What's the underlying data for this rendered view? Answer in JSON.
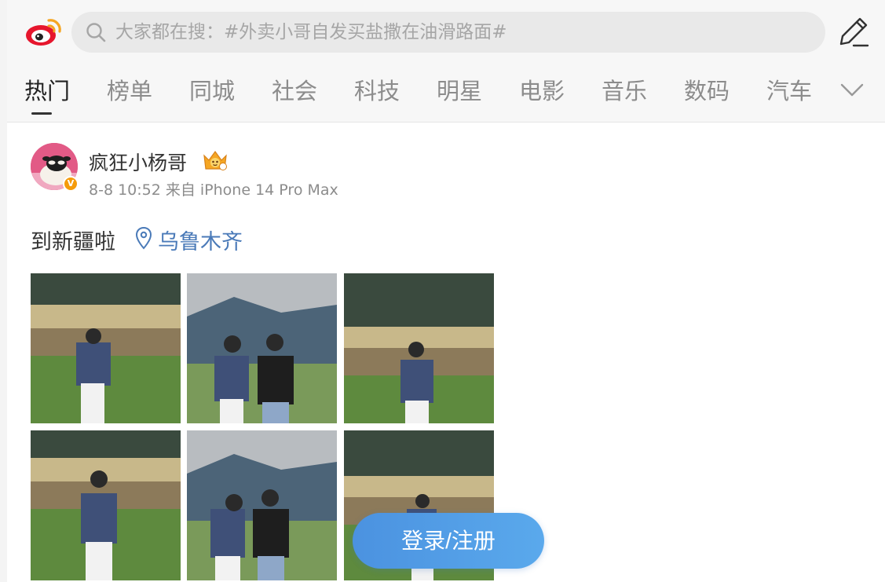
{
  "search": {
    "placeholder": "大家都在搜：#外卖小哥自发买盐撒在油滑路面#"
  },
  "tabs": [
    {
      "label": "热门",
      "active": true
    },
    {
      "label": "榜单"
    },
    {
      "label": "同城"
    },
    {
      "label": "社会"
    },
    {
      "label": "科技"
    },
    {
      "label": "明星"
    },
    {
      "label": "电影"
    },
    {
      "label": "音乐"
    },
    {
      "label": "数码"
    },
    {
      "label": "汽车"
    }
  ],
  "icons": {
    "logo": "weibo-logo-icon",
    "search": "search-icon",
    "compose": "compose-pencil-icon",
    "more": "chevron-down-icon",
    "location": "location-pin-icon",
    "verified": "verified-badge-icon",
    "member": "member-crown-badge-icon"
  },
  "post": {
    "username": "疯狂小杨哥",
    "meta": "8-8 10:52 来自 iPhone 14 Pro Max",
    "text": "到新疆啦",
    "location": "乌鲁木齐",
    "verified_badge": "V",
    "photo_count": 6
  },
  "login_button": "登录/注册",
  "colors": {
    "accent": "#4a7ab8",
    "login_gradient_start": "#4b92e0",
    "login_gradient_end": "#5aa9ec",
    "verified": "#f59b0b"
  }
}
